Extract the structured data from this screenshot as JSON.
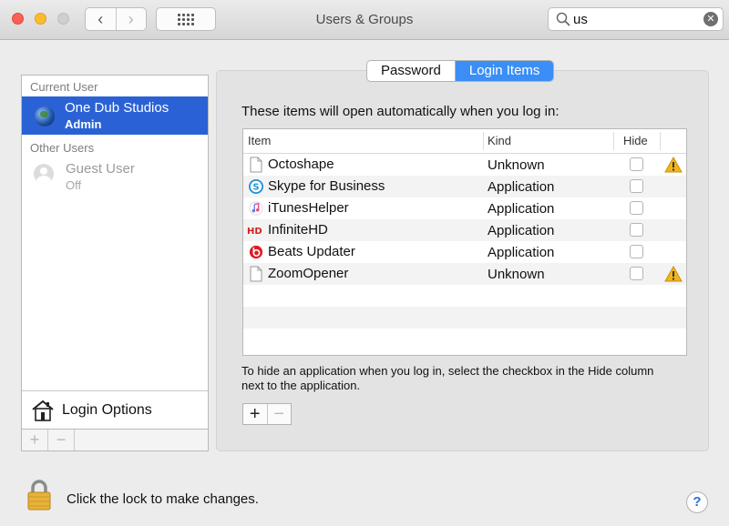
{
  "window": {
    "title": "Users & Groups"
  },
  "search": {
    "value": "us",
    "clear_glyph": "✕"
  },
  "nav": {
    "back_glyph": "‹",
    "forward_glyph": "›"
  },
  "sidebar": {
    "current_user_label": "Current User",
    "current_user": {
      "name": "One Dub Studios",
      "role": "Admin"
    },
    "other_users_label": "Other Users",
    "other_users": [
      {
        "name": "Guest User",
        "status": "Off"
      }
    ],
    "login_options_label": "Login Options",
    "add_glyph": "+",
    "remove_glyph": "−"
  },
  "tabs": [
    {
      "label": "Password",
      "selected": false
    },
    {
      "label": "Login Items",
      "selected": true
    }
  ],
  "main": {
    "intro": "These items will open automatically when you log in:",
    "columns": {
      "item": "Item",
      "kind": "Kind",
      "hide": "Hide"
    },
    "rows": [
      {
        "name": "Octoshape",
        "kind": "Unknown",
        "hide": false,
        "icon": "document-icon",
        "warning": true
      },
      {
        "name": "Skype for Business",
        "kind": "Application",
        "hide": false,
        "icon": "skype-icon",
        "warning": false
      },
      {
        "name": "iTunesHelper",
        "kind": "Application",
        "hide": false,
        "icon": "itunes-icon",
        "warning": false
      },
      {
        "name": "InfiniteHD",
        "kind": "Application",
        "hide": false,
        "icon": "infinitehd-icon",
        "warning": false
      },
      {
        "name": "Beats Updater",
        "kind": "Application",
        "hide": false,
        "icon": "beats-icon",
        "warning": false
      },
      {
        "name": "ZoomOpener",
        "kind": "Unknown",
        "hide": false,
        "icon": "document-icon",
        "warning": true
      }
    ],
    "help_text": "To hide an application when you log in, select the checkbox in the Hide column next to the application.",
    "add_glyph": "+",
    "remove_glyph": "−"
  },
  "footer": {
    "lock_text": "Click the lock to make changes.",
    "help_glyph": "?"
  },
  "colors": {
    "accent": "#3a8ef5",
    "selection": "#2a62d6",
    "warning": "#f2b41c"
  }
}
